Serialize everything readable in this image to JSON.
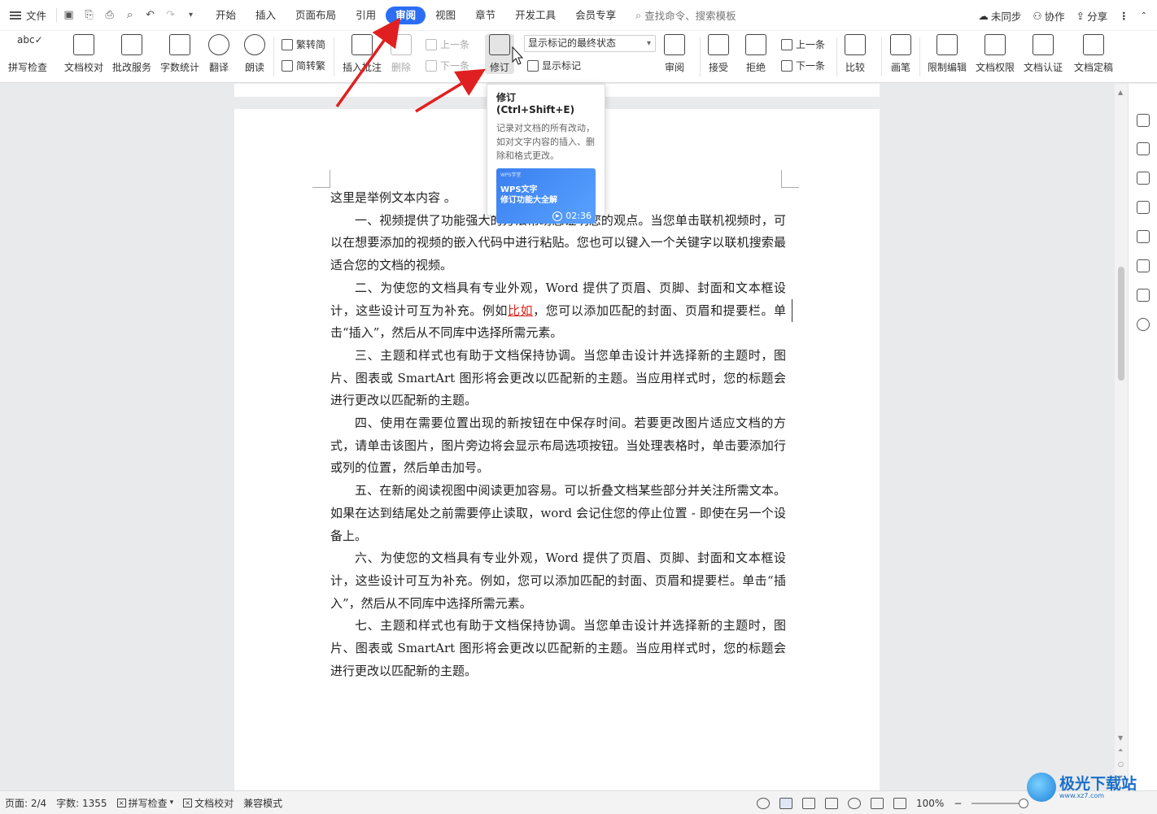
{
  "menubar": {
    "file_label": "文件",
    "tabs": [
      "开始",
      "插入",
      "页面布局",
      "引用",
      "审阅",
      "视图",
      "章节",
      "开发工具",
      "会员专享"
    ],
    "active_tab": "审阅",
    "search_placeholder": "查找命令、搜索模板",
    "sync": "未同步",
    "collab": "协作",
    "share": "分享"
  },
  "ribbon": {
    "spellcheck": "拼写检查",
    "doc_proof": "文档校对",
    "correction_service": "批改服务",
    "word_count": "字数统计",
    "translate": "翻译",
    "read_aloud": "朗读",
    "trad_to_simp": "繁转简",
    "simp_to_trad": "简转繁",
    "insert_comment": "插入批注",
    "delete": "删除",
    "prev_comment": "上一条",
    "next_comment": "下一条",
    "track_changes": "修订",
    "markup_display_select": "显示标记的最终状态",
    "show_markup": "显示标记",
    "review_pane": "审阅",
    "accept": "接受",
    "reject": "拒绝",
    "prev_change": "上一条",
    "next_change": "下一条",
    "compare": "比较",
    "ink": "画笔",
    "restrict_edit": "限制编辑",
    "doc_permission": "文档权限",
    "doc_certify": "文档认证",
    "doc_finalize": "文档定稿"
  },
  "tooltip": {
    "title": "修订 (Ctrl+Shift+E)",
    "description": "记录对文档的所有改动，如对文字内容的插入、删除和格式更改。",
    "thumb_brand": "WPS学堂",
    "thumb_title_line1": "WPS文字",
    "thumb_title_line2": "修订功能大全解",
    "thumb_duration": "02:36"
  },
  "document": {
    "first_line": "这里是举例文本内容 。",
    "p1": "一、视频提供了功能强大的方法帮助您证明您的观点。当您单击联机视频时，可以在想要添加的视频的嵌入代码中进行粘贴。您也可以键入一个关键字以联机搜索最适合您的文档的视频。",
    "p2_before": "二、为使您的文档具有专业外观，Word 提供了页眉、页脚、封面和文本框设计，这些设计可互为补充。例如",
    "p2_inserted": "比如",
    "p2_after": "，您可以添加匹配的封面、页眉和提要栏。单击“插入”，然后从不同库中选择所需元素。",
    "p3": "三、主题和样式也有助于文档保持协调。当您单击设计并选择新的主题时，图片、图表或 SmartArt 图形将会更改以匹配新的主题。当应用样式时，您的标题会进行更改以匹配新的主题。",
    "p4": "四、使用在需要位置出现的新按钮在中保存时间。若要更改图片适应文档的方式，请单击该图片，图片旁边将会显示布局选项按钮。当处理表格时，单击要添加行或列的位置，然后单击加号。",
    "p5": "五、在新的阅读视图中阅读更加容易。可以折叠文档某些部分并关注所需文本。如果在达到结尾处之前需要停止读取，word 会记住您的停止位置 - 即使在另一个设备上。",
    "p6": "六、为使您的文档具有专业外观，Word 提供了页眉、页脚、封面和文本框设计，这些设计可互为补充。例如，您可以添加匹配的封面、页眉和提要栏。单击“插入”，然后从不同库中选择所需元素。",
    "p7": "七、主题和样式也有助于文档保持协调。当您单击设计并选择新的主题时，图片、图表或 SmartArt 图形将会更改以匹配新的主题。当应用样式时，您的标题会进行更改以匹配新的主题。"
  },
  "statusbar": {
    "page": "页面: 2/4",
    "word_count": "字数: 1355",
    "spellcheck": "拼写检查",
    "doc_proof": "文档校对",
    "compat_mode": "兼容模式",
    "zoom": "100%"
  },
  "watermark": {
    "cn": "极光下载站",
    "en": "www.xz7.com"
  },
  "colors": {
    "accent": "#2b6ef5",
    "revision_red": "#d9251c",
    "arrow_red": "#e02020"
  }
}
